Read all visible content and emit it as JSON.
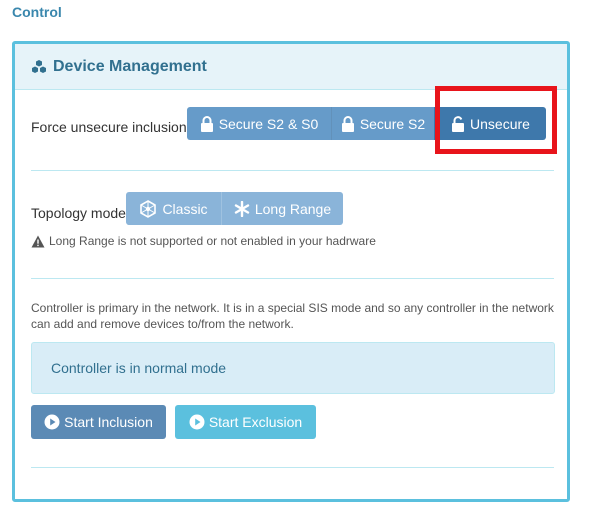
{
  "section": {
    "title": "Control"
  },
  "panel": {
    "title": "Device Management"
  },
  "inclusion": {
    "label": "Force unsecure inclusion",
    "buttons": [
      "Secure S2 & S0",
      "Secure S2",
      "Unsecure"
    ],
    "selected": "Unsecure"
  },
  "topology": {
    "label": "Topology mode",
    "buttons": [
      "Classic",
      "Long Range"
    ],
    "warning": "Long Range is not supported or not enabled in your hadrware"
  },
  "controller": {
    "description": "Controller is primary in the network. It is in a special SIS mode and so any controller in the network can add and remove devices to/from the network.",
    "status": "Controller is in normal mode",
    "start_inclusion": "Start Inclusion",
    "start_exclusion": "Start Exclusion"
  },
  "colors": {
    "accent": "#3a87ad",
    "panel_border": "#5bc0de",
    "primary": "#337ab7",
    "info": "#5bc0de",
    "highlight": "#e8141b"
  },
  "icons": {
    "panel": "cubes-icon",
    "lock": "lock-icon",
    "unlock": "unlock-icon",
    "classic": "network-icon",
    "long_range": "asterisk-icon",
    "warning": "warning-icon",
    "play": "play-circle-icon"
  }
}
